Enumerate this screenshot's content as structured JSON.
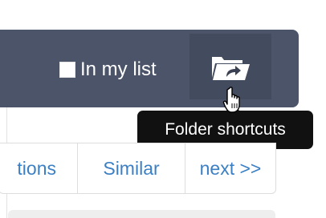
{
  "toolbar": {
    "in_my_list_label": "In my list",
    "folder_button_icon": "folder-shortcut-icon"
  },
  "tooltip": {
    "text": "Folder shortcuts"
  },
  "tabs": [
    {
      "label": "tions"
    },
    {
      "label": "Similar"
    },
    {
      "label": "next >>"
    }
  ],
  "colors": {
    "toolbar_bg": "#4b5468",
    "tooltip_bg": "#111111",
    "link": "#3b7fc4"
  }
}
